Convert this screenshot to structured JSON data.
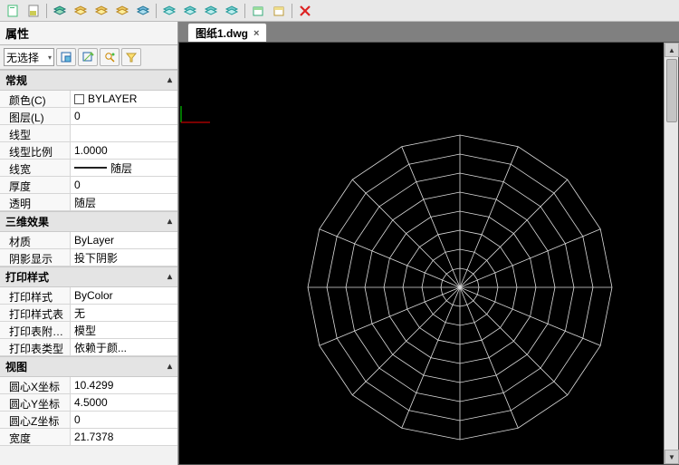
{
  "toolbar_icons": [
    "doc1",
    "doc2",
    "stack-green",
    "stack-yellow1",
    "stack-yellow2",
    "stack-yellow3",
    "stack-blue",
    "stack-teal1",
    "stack-teal2",
    "stack-teal3",
    "stack-teal4",
    "sheet-green",
    "sheet-yellow",
    "delete-x"
  ],
  "panel": {
    "title": "属性",
    "selector_label": "无选择",
    "tool_icons": [
      "toggle",
      "pin",
      "qselect",
      "filter"
    ]
  },
  "sections": [
    {
      "key": "general",
      "title": "常规",
      "rows": [
        {
          "label": "颜色(C)",
          "value": "BYLAYER",
          "swatch": true
        },
        {
          "label": "图层(L)",
          "value": "0"
        },
        {
          "label": "线型",
          "value": ""
        },
        {
          "label": "线型比例",
          "value": "1.0000"
        },
        {
          "label": "线宽",
          "value": "随层",
          "lw": true
        },
        {
          "label": "厚度",
          "value": "0"
        },
        {
          "label": "透明",
          "value": "随层"
        }
      ]
    },
    {
      "key": "effect3d",
      "title": "三维效果",
      "rows": [
        {
          "label": "材质",
          "value": "ByLayer"
        },
        {
          "label": "阴影显示",
          "value": "投下阴影"
        }
      ]
    },
    {
      "key": "plot",
      "title": "打印样式",
      "rows": [
        {
          "label": "打印样式",
          "value": "ByColor"
        },
        {
          "label": "打印样式表",
          "value": "无"
        },
        {
          "label": "打印表附加到",
          "value": "模型"
        },
        {
          "label": "打印表类型",
          "value": "依赖于颜..."
        }
      ]
    },
    {
      "key": "view",
      "title": "视图",
      "rows": [
        {
          "label": "圆心X坐标",
          "value": "10.4299"
        },
        {
          "label": "圆心Y坐标",
          "value": "4.5000"
        },
        {
          "label": "圆心Z坐标",
          "value": "0"
        },
        {
          "label": "宽度",
          "value": "21.7378"
        }
      ]
    }
  ],
  "tab": {
    "name": "图纸1.dwg",
    "close": "×"
  },
  "chart_data": {
    "type": "polar-web",
    "rings": 8,
    "spokes": 16,
    "title": "",
    "description": "CAD polar/spider wireframe with 16 radial spokes and 8 concentric polygonal rings on black background"
  },
  "collapse_glyph": "▴"
}
